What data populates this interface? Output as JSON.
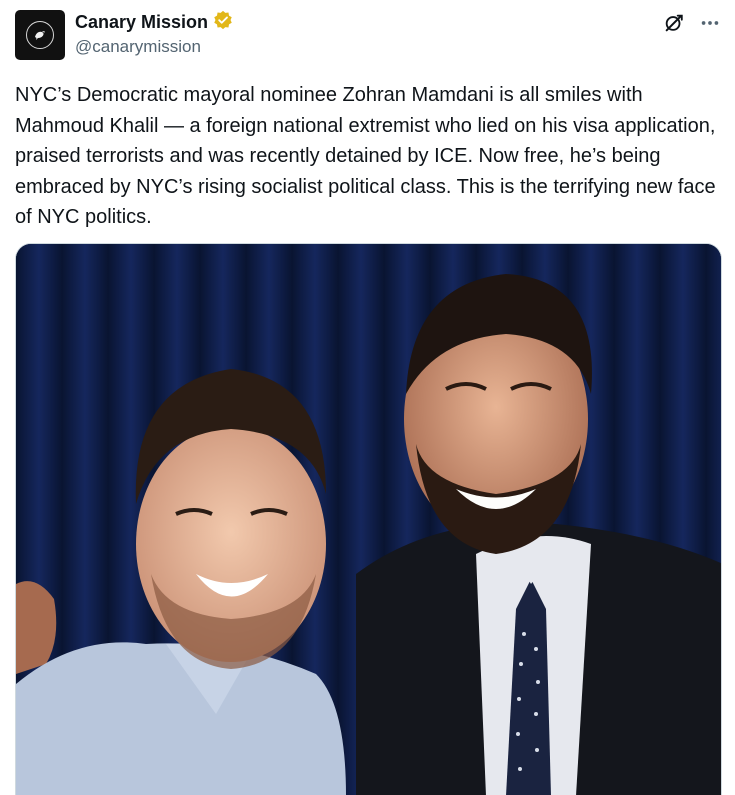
{
  "author": {
    "display_name": "Canary Mission",
    "handle": "@canarymission",
    "verified_badge_color": "#e2b719",
    "avatar_bg": "#111111"
  },
  "icons": {
    "verified": "verified-badge-icon",
    "grok": "grok-icon",
    "more": "more-options-icon"
  },
  "tweet": {
    "text": "NYC’s Democratic mayoral nominee Zohran Mamdani is all smiles with Mahmoud Khalil — a foreign national extremist who lied on his visa application,  praised terrorists and was recently detained by ICE. Now free, he’s being embraced by NYC’s rising socialist political class. This is the terrifying new face of NYC politics."
  },
  "media": {
    "type": "photo",
    "background_color": "#0c1a3d"
  }
}
